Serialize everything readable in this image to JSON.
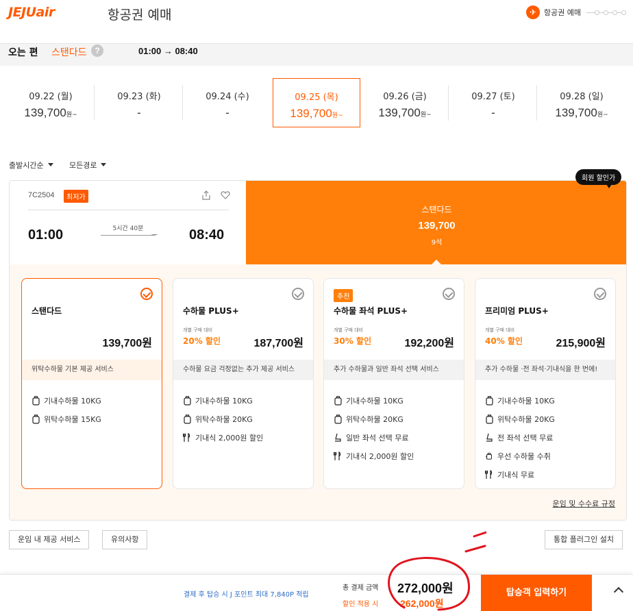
{
  "header": {
    "logo": "JEJUair",
    "title": "항공권 예매",
    "step_label": "항공권 예매"
  },
  "journey": {
    "direction": "오는 편",
    "fare_type": "스탠다드",
    "help": "?",
    "times": "01:00 → 08:40"
  },
  "dates": [
    {
      "label": "09.22 (월)",
      "price": "139,700",
      "unit": "원~"
    },
    {
      "label": "09.23 (화)",
      "price": "-",
      "unit": ""
    },
    {
      "label": "09.24 (수)",
      "price": "-",
      "unit": ""
    },
    {
      "label": "09.25 (목)",
      "price": "139,700",
      "unit": "원~"
    },
    {
      "label": "09.26 (금)",
      "price": "139,700",
      "unit": "원~"
    },
    {
      "label": "09.27 (토)",
      "price": "-",
      "unit": ""
    },
    {
      "label": "09.28 (일)",
      "price": "139,700",
      "unit": "원~"
    }
  ],
  "filters": {
    "sort": "출발시간순",
    "route": "모든경로"
  },
  "flight": {
    "number": "7C2504",
    "badge": "최저가",
    "departure": "01:00",
    "arrival": "08:40",
    "duration": "5시간 40분",
    "selected_fare": "스탠다드",
    "selected_price": "139,700",
    "seats": "9석",
    "member_badge": "회원 할인가"
  },
  "fares": [
    {
      "name": "스탠다드",
      "badge": "",
      "disc_caption": "",
      "discount": "",
      "price": "139,700원",
      "desc": "위탁수하물 기본 제공 서비스",
      "features": [
        {
          "icon": "luggage-icon",
          "label": "기내수하물 10KG"
        },
        {
          "icon": "luggage-icon",
          "label": "위탁수하물 15KG"
        }
      ]
    },
    {
      "name": "수하물 PLUS+",
      "badge": "",
      "disc_caption": "개별 구매 대비",
      "discount": "20% 할인",
      "price": "187,700원",
      "desc": "수하물 요금 걱정없는 추가 제공 서비스",
      "features": [
        {
          "icon": "luggage-icon",
          "label": "기내수하물 10KG"
        },
        {
          "icon": "luggage-icon",
          "label": "위탁수하물 20KG"
        },
        {
          "icon": "meal-icon",
          "label": "기내식 2,000원 할인"
        }
      ]
    },
    {
      "name": "수하물 좌석 PLUS+",
      "badge": "추천",
      "disc_caption": "개별 구매 대비",
      "discount": "30% 할인",
      "price": "192,200원",
      "desc": "추가 수하물과 일반 좌석 선택 서비스",
      "features": [
        {
          "icon": "luggage-icon",
          "label": "기내수하물 10KG"
        },
        {
          "icon": "luggage-icon",
          "label": "위탁수하물 20KG"
        },
        {
          "icon": "seat-icon",
          "label": "일반 좌석 선택 무료"
        },
        {
          "icon": "meal-icon",
          "label": "기내식 2,000원 할인"
        }
      ]
    },
    {
      "name": "프리미엄 PLUS+",
      "badge": "",
      "disc_caption": "개별 구매 대비",
      "discount": "40% 할인",
      "price": "215,900원",
      "desc": "추가 수하물 ·전 좌석·기내식을 한 번에!",
      "features": [
        {
          "icon": "luggage-icon",
          "label": "기내수하물 10KG"
        },
        {
          "icon": "luggage-icon",
          "label": "위탁수하물 20KG"
        },
        {
          "icon": "seat-icon",
          "label": "전 좌석 선택 무료"
        },
        {
          "icon": "priority-bag-icon",
          "label": "우선 수하물 수취"
        },
        {
          "icon": "meal-icon",
          "label": "기내식 무료"
        }
      ]
    }
  ],
  "fare_rules": "운임 및 수수료 규정",
  "buttons": {
    "included": "운임 내 제공 서비스",
    "notice": "유의사항",
    "plugin": "통합 플러그인 설치"
  },
  "footer": {
    "points_note": "결제 후 탑승 시 J 포인트 최대 7,840P 적립",
    "total_label": "총 결제 금액",
    "total_price": "272,000원",
    "disc_label": "할인 적용 시",
    "disc_price": "262,000원",
    "pay_button": "탑승객 입력하기"
  },
  "colors": {
    "brand": "#ff5a00",
    "fare_banner": "#ff7f0a",
    "annotation": "#e0141e"
  }
}
